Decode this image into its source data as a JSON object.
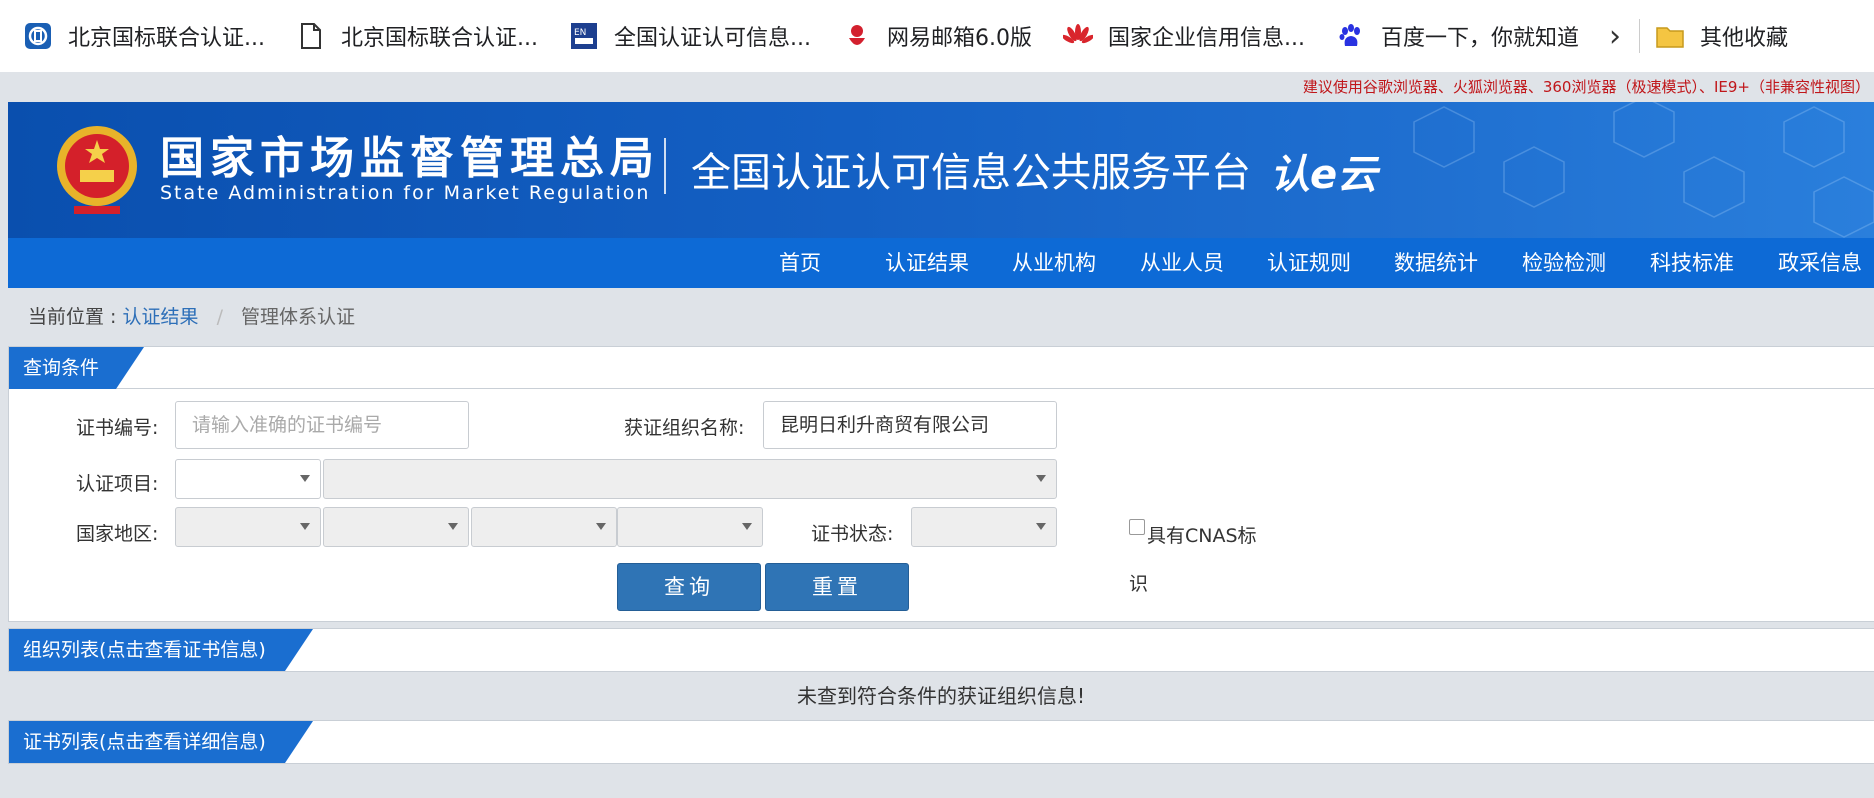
{
  "bookmarks": [
    {
      "label": "北京国标联合认证...",
      "icon": "bj-logo-icon"
    },
    {
      "label": "北京国标联合认证...",
      "icon": "document-icon"
    },
    {
      "label": "全国认证认可信息...",
      "icon": "cnca-icon"
    },
    {
      "label": "网易邮箱6.0版",
      "icon": "netease-mail-icon"
    },
    {
      "label": "国家企业信用信息...",
      "icon": "huawei-icon"
    },
    {
      "label": "百度一下，你就知道",
      "icon": "baidu-paw-icon"
    }
  ],
  "other_bookmarks": "其他收藏",
  "notice": "建议使用谷歌浏览器、火狐浏览器、360浏览器（极速模式）、IE9+（非兼容性视图）",
  "header": {
    "org_cn": "国家市场监督管理总局",
    "org_en": "State Administration for Market Regulation",
    "platform": "全国认证认可信息公共服务平台",
    "logo": "认e云"
  },
  "nav": [
    "首页",
    "认证结果",
    "从业机构",
    "从业人员",
    "认证规则",
    "数据统计",
    "检验检测",
    "科技标准",
    "政采信息"
  ],
  "breadcrumb": {
    "prefix": "当前位置 :",
    "link": "认证结果",
    "sep": "/",
    "current": "管理体系认证"
  },
  "query": {
    "title": "查询条件",
    "cert_no_label": "证书编号:",
    "cert_no_placeholder": "请输入准确的证书编号",
    "org_name_label": "获证组织名称:",
    "org_name_value": "昆明日利升商贸有限公司",
    "project_label": "认证项目:",
    "region_label": "国家地区:",
    "status_label": "证书状态:",
    "cnas_label": "具有CNAS标",
    "cnas_label2": "识",
    "search_btn": "查询",
    "reset_btn": "重置"
  },
  "org_list": {
    "title": "组织列表(点击查看证书信息)",
    "empty": "未查到符合条件的获证组织信息!"
  },
  "cert_list": {
    "title": "证书列表(点击查看详细信息)"
  },
  "colors": {
    "nav_bg": "#0d6ad6",
    "tab_bg": "#1a6ed0",
    "button": "#2f74b5",
    "notice": "#c0161a"
  }
}
